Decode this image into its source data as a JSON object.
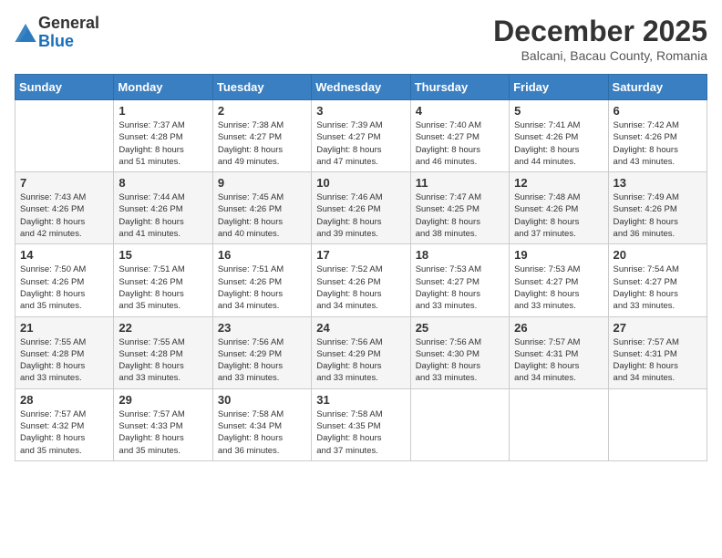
{
  "logo": {
    "general": "General",
    "blue": "Blue"
  },
  "header": {
    "month": "December 2025",
    "location": "Balcani, Bacau County, Romania"
  },
  "days_of_week": [
    "Sunday",
    "Monday",
    "Tuesday",
    "Wednesday",
    "Thursday",
    "Friday",
    "Saturday"
  ],
  "weeks": [
    [
      {
        "day": "",
        "info": ""
      },
      {
        "day": "1",
        "info": "Sunrise: 7:37 AM\nSunset: 4:28 PM\nDaylight: 8 hours\nand 51 minutes."
      },
      {
        "day": "2",
        "info": "Sunrise: 7:38 AM\nSunset: 4:27 PM\nDaylight: 8 hours\nand 49 minutes."
      },
      {
        "day": "3",
        "info": "Sunrise: 7:39 AM\nSunset: 4:27 PM\nDaylight: 8 hours\nand 47 minutes."
      },
      {
        "day": "4",
        "info": "Sunrise: 7:40 AM\nSunset: 4:27 PM\nDaylight: 8 hours\nand 46 minutes."
      },
      {
        "day": "5",
        "info": "Sunrise: 7:41 AM\nSunset: 4:26 PM\nDaylight: 8 hours\nand 44 minutes."
      },
      {
        "day": "6",
        "info": "Sunrise: 7:42 AM\nSunset: 4:26 PM\nDaylight: 8 hours\nand 43 minutes."
      }
    ],
    [
      {
        "day": "7",
        "info": "Sunrise: 7:43 AM\nSunset: 4:26 PM\nDaylight: 8 hours\nand 42 minutes."
      },
      {
        "day": "8",
        "info": "Sunrise: 7:44 AM\nSunset: 4:26 PM\nDaylight: 8 hours\nand 41 minutes."
      },
      {
        "day": "9",
        "info": "Sunrise: 7:45 AM\nSunset: 4:26 PM\nDaylight: 8 hours\nand 40 minutes."
      },
      {
        "day": "10",
        "info": "Sunrise: 7:46 AM\nSunset: 4:26 PM\nDaylight: 8 hours\nand 39 minutes."
      },
      {
        "day": "11",
        "info": "Sunrise: 7:47 AM\nSunset: 4:25 PM\nDaylight: 8 hours\nand 38 minutes."
      },
      {
        "day": "12",
        "info": "Sunrise: 7:48 AM\nSunset: 4:26 PM\nDaylight: 8 hours\nand 37 minutes."
      },
      {
        "day": "13",
        "info": "Sunrise: 7:49 AM\nSunset: 4:26 PM\nDaylight: 8 hours\nand 36 minutes."
      }
    ],
    [
      {
        "day": "14",
        "info": "Sunrise: 7:50 AM\nSunset: 4:26 PM\nDaylight: 8 hours\nand 35 minutes."
      },
      {
        "day": "15",
        "info": "Sunrise: 7:51 AM\nSunset: 4:26 PM\nDaylight: 8 hours\nand 35 minutes."
      },
      {
        "day": "16",
        "info": "Sunrise: 7:51 AM\nSunset: 4:26 PM\nDaylight: 8 hours\nand 34 minutes."
      },
      {
        "day": "17",
        "info": "Sunrise: 7:52 AM\nSunset: 4:26 PM\nDaylight: 8 hours\nand 34 minutes."
      },
      {
        "day": "18",
        "info": "Sunrise: 7:53 AM\nSunset: 4:27 PM\nDaylight: 8 hours\nand 33 minutes."
      },
      {
        "day": "19",
        "info": "Sunrise: 7:53 AM\nSunset: 4:27 PM\nDaylight: 8 hours\nand 33 minutes."
      },
      {
        "day": "20",
        "info": "Sunrise: 7:54 AM\nSunset: 4:27 PM\nDaylight: 8 hours\nand 33 minutes."
      }
    ],
    [
      {
        "day": "21",
        "info": "Sunrise: 7:55 AM\nSunset: 4:28 PM\nDaylight: 8 hours\nand 33 minutes."
      },
      {
        "day": "22",
        "info": "Sunrise: 7:55 AM\nSunset: 4:28 PM\nDaylight: 8 hours\nand 33 minutes."
      },
      {
        "day": "23",
        "info": "Sunrise: 7:56 AM\nSunset: 4:29 PM\nDaylight: 8 hours\nand 33 minutes."
      },
      {
        "day": "24",
        "info": "Sunrise: 7:56 AM\nSunset: 4:29 PM\nDaylight: 8 hours\nand 33 minutes."
      },
      {
        "day": "25",
        "info": "Sunrise: 7:56 AM\nSunset: 4:30 PM\nDaylight: 8 hours\nand 33 minutes."
      },
      {
        "day": "26",
        "info": "Sunrise: 7:57 AM\nSunset: 4:31 PM\nDaylight: 8 hours\nand 34 minutes."
      },
      {
        "day": "27",
        "info": "Sunrise: 7:57 AM\nSunset: 4:31 PM\nDaylight: 8 hours\nand 34 minutes."
      }
    ],
    [
      {
        "day": "28",
        "info": "Sunrise: 7:57 AM\nSunset: 4:32 PM\nDaylight: 8 hours\nand 35 minutes."
      },
      {
        "day": "29",
        "info": "Sunrise: 7:57 AM\nSunset: 4:33 PM\nDaylight: 8 hours\nand 35 minutes."
      },
      {
        "day": "30",
        "info": "Sunrise: 7:58 AM\nSunset: 4:34 PM\nDaylight: 8 hours\nand 36 minutes."
      },
      {
        "day": "31",
        "info": "Sunrise: 7:58 AM\nSunset: 4:35 PM\nDaylight: 8 hours\nand 37 minutes."
      },
      {
        "day": "",
        "info": ""
      },
      {
        "day": "",
        "info": ""
      },
      {
        "day": "",
        "info": ""
      }
    ]
  ]
}
